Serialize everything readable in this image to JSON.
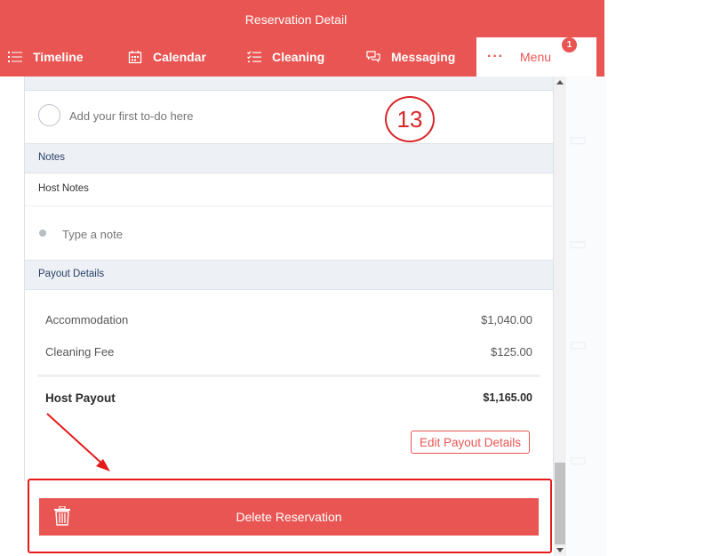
{
  "header": {
    "title": "Reservation Detail",
    "nav": [
      {
        "label": "Timeline",
        "icon": "list-icon"
      },
      {
        "label": "Calendar",
        "icon": "calendar-icon"
      },
      {
        "label": "Cleaning",
        "icon": "checklist-icon"
      },
      {
        "label": "Messaging",
        "icon": "chat-icon"
      }
    ],
    "menu": {
      "label": "Menu",
      "dots": "···",
      "badge": "1"
    }
  },
  "todo": {
    "placeholder": "Add your first to-do here"
  },
  "notes": {
    "section_title": "Notes",
    "host_notes_label": "Host Notes",
    "placeholder": "Type a note"
  },
  "payout": {
    "section_title": "Payout Details",
    "rows": [
      {
        "label": "Accommodation",
        "amount": "$1,040.00"
      },
      {
        "label": "Cleaning Fee",
        "amount": "$125.00"
      }
    ],
    "total": {
      "label": "Host Payout",
      "amount": "$1,165.00"
    },
    "edit_label": "Edit Payout Details"
  },
  "actions": {
    "delete_label": "Delete Reservation"
  },
  "annotation": {
    "step_number": "13"
  },
  "colors": {
    "brand": "#e95552",
    "annotation": "#e51a1a"
  }
}
